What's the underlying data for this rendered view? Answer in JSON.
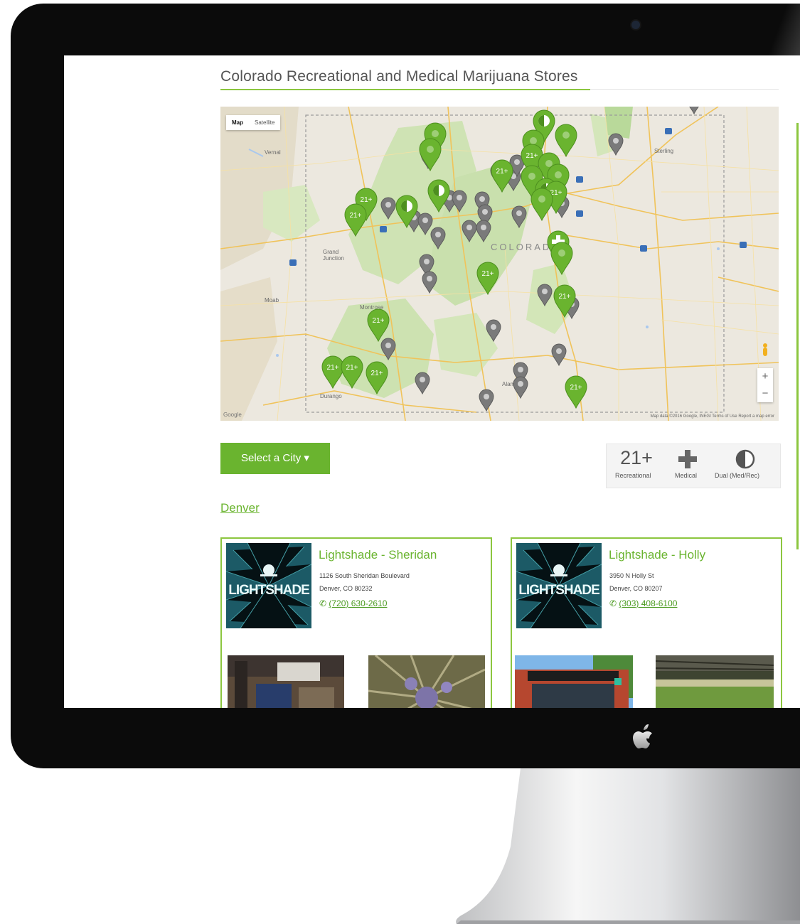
{
  "page": {
    "title": "Colorado Recreational and Medical Marijuana Stores"
  },
  "map": {
    "toggle": [
      "Map",
      "Satellite"
    ],
    "zoom_in": "+",
    "zoom_out": "−",
    "state_label": "COLORADO",
    "attribution": "Map data ©2016 Google, INEGI    Terms of Use    Report a map error",
    "google_logo": "Google",
    "places": [
      "Vernal",
      "Grand Junction",
      "Moab",
      "Durango",
      "Alamosa",
      "Montrose",
      "Sterling"
    ],
    "pin_label_recreational": "21+",
    "pin_colors": {
      "recreational": "#6ab42f",
      "other": "#7a7a7a"
    }
  },
  "controls": {
    "select_city": "Select a City ▾"
  },
  "legend": [
    {
      "icon": "21+",
      "label": "Recreational"
    },
    {
      "icon": "cross-icon",
      "label": "Medical"
    },
    {
      "icon": "half-circle-icon",
      "label": "Dual (Med/Rec)"
    }
  ],
  "city": "Denver",
  "stores": [
    {
      "name": "Lightshade - Sheridan",
      "address1": "1126 South Sheridan Boulevard",
      "address2": "Denver, CO 80232",
      "phone": "(720) 630-2610",
      "logo_text": "LIGHTSHADE"
    },
    {
      "name": "Lightshade - Holly",
      "address1": "3950 N Holly St",
      "address2": "Denver, CO 80207",
      "phone": "(303) 408-6100",
      "logo_text": "LIGHTSHADE"
    }
  ],
  "colors": {
    "accent": "#6ab42f",
    "bezel": "#0b0b0b"
  }
}
